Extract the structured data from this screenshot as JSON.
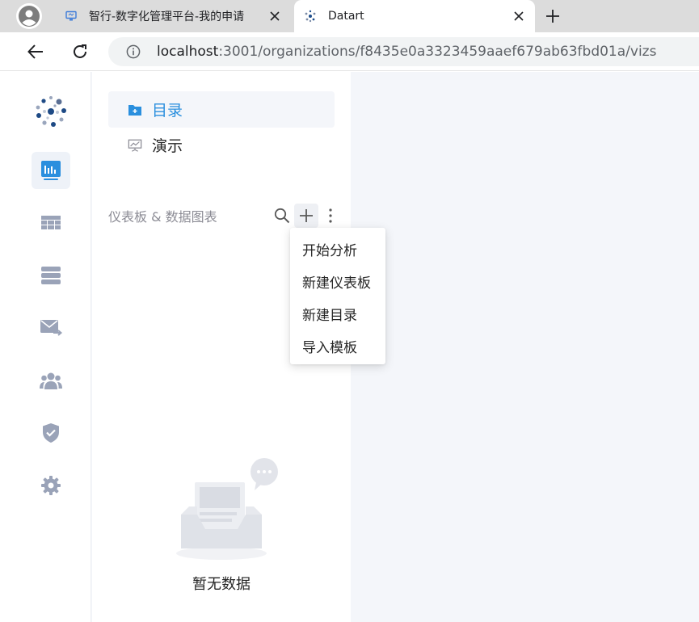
{
  "browser": {
    "tabs": [
      {
        "title": "智行-数字化管理平台-我的申请",
        "active": false
      },
      {
        "title": "Datart",
        "active": true
      }
    ],
    "url_host": "localhost",
    "url_path": ":3001/organizations/f8435e0a3323459aaef679ab63fbd01a/vizs"
  },
  "rail": {
    "icons": [
      "logo-icon",
      "viz-icon",
      "table-icon",
      "source-icon",
      "schedule-mail-icon",
      "members-icon",
      "permission-shield-icon",
      "settings-gear-icon"
    ],
    "active": "viz-icon"
  },
  "sidebar": {
    "menu": [
      {
        "label": "目录",
        "icon": "folder-add-icon",
        "active": true
      },
      {
        "label": "演示",
        "icon": "presentation-icon",
        "active": false
      }
    ],
    "section_title": "仪表板 & 数据图表",
    "empty_text": "暂无数据"
  },
  "dropdown": {
    "items": [
      "开始分析",
      "新建仪表板",
      "新建目录",
      "导入模板"
    ]
  },
  "colors": {
    "accent": "#2a8fde",
    "rail_icon": "#9aa3b8",
    "background": "#f4f6fa"
  }
}
